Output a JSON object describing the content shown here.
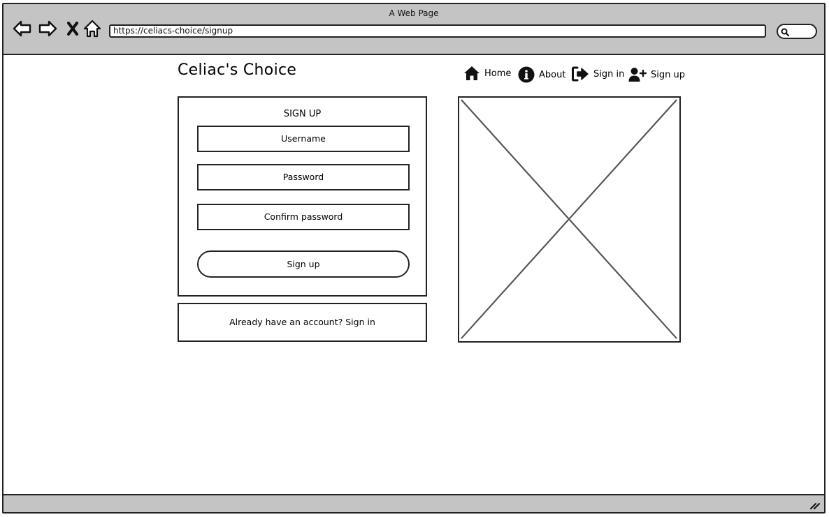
{
  "window": {
    "title": "A Web Page",
    "url": "https://celiacs-choice/signup"
  },
  "browser_controls": {
    "back_icon": "back-arrow-icon",
    "forward_icon": "forward-arrow-icon",
    "stop_icon": "close-icon",
    "home_icon": "home-outline-icon",
    "search_icon": "search-icon"
  },
  "site": {
    "brand": "Celiac's Choice"
  },
  "nav": {
    "items": [
      {
        "label": "Home",
        "icon": "home-icon"
      },
      {
        "label": "About",
        "icon": "info-icon"
      },
      {
        "label": "Sign in",
        "icon": "sign-in-icon"
      },
      {
        "label": "Sign up",
        "icon": "user-plus-icon"
      }
    ]
  },
  "signup_form": {
    "heading": "SIGN UP",
    "username_placeholder": "Username",
    "password_placeholder": "Password",
    "confirm_placeholder": "Confirm password",
    "submit_label": "Sign up"
  },
  "signin_prompt": {
    "text": "Already have an account? Sign in"
  },
  "colors": {
    "chrome": "#c4c4c4",
    "stroke": "#222222",
    "placeholder_cross": "#555555"
  }
}
